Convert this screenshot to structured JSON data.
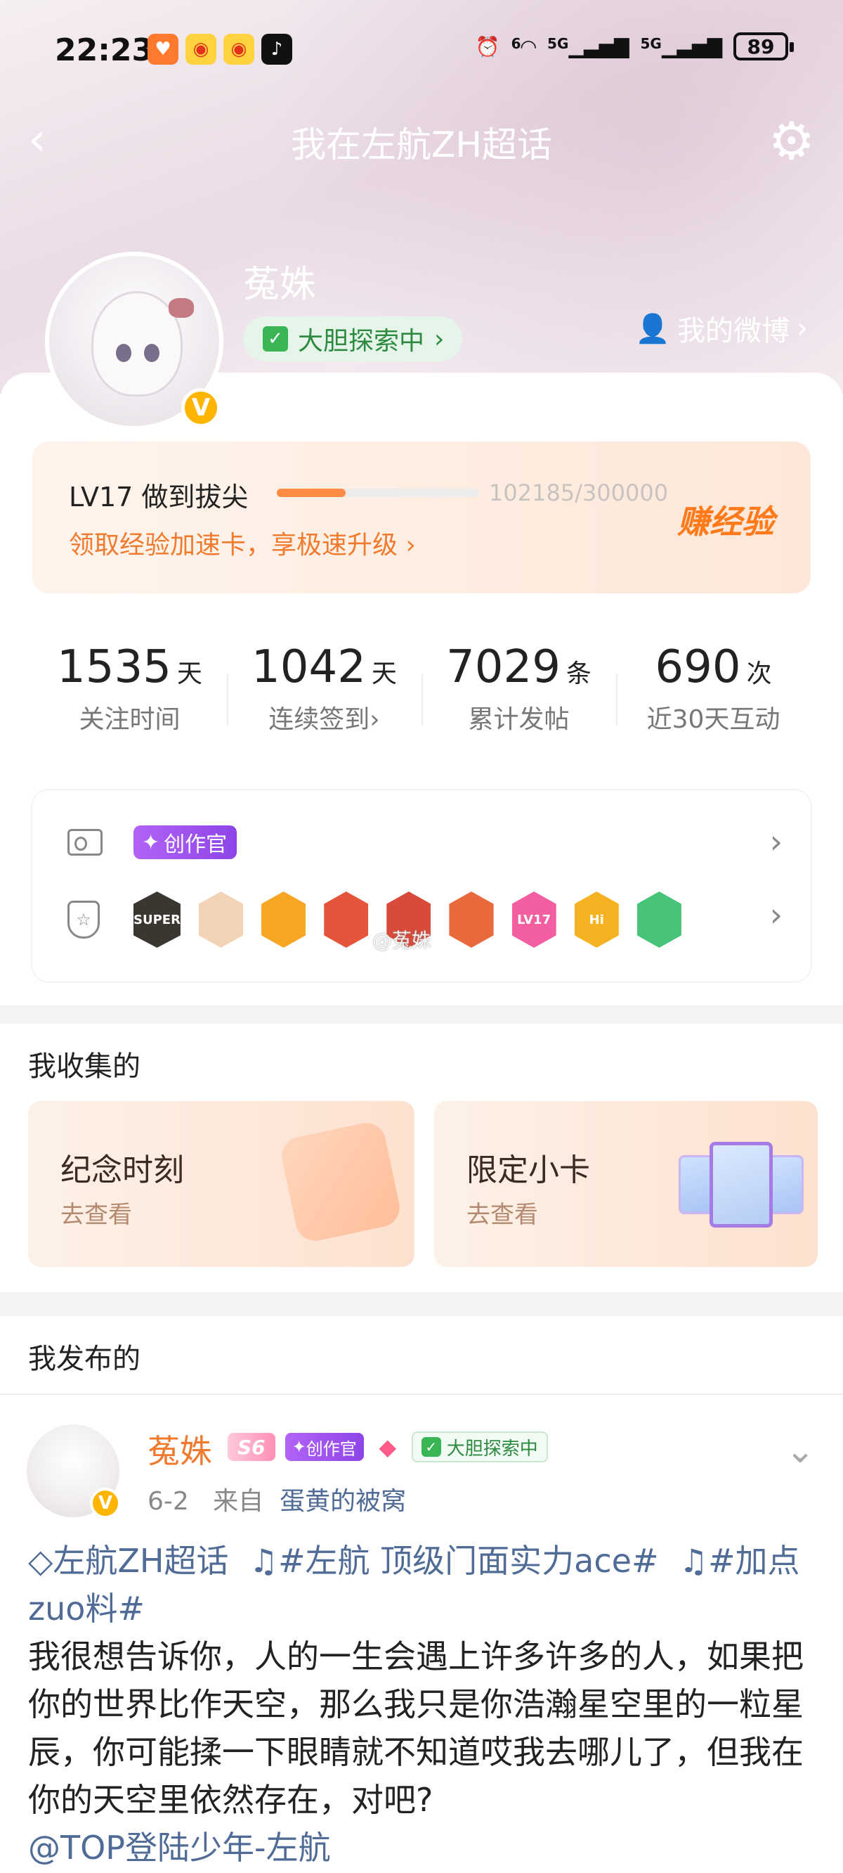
{
  "status_bar": {
    "time": "22:23",
    "battery": "89",
    "signal_labels": [
      "6",
      "5G",
      "5G"
    ]
  },
  "nav": {
    "title": "我在左航ZH超话"
  },
  "profile": {
    "username": "菟姝",
    "explore_tag": "大胆探索中",
    "my_weibo": "我的微博",
    "verified_mark": "V"
  },
  "level": {
    "title": "LV17 做到拔尖",
    "progress_text": "102185/300000",
    "progress_fraction": 0.3406,
    "link": "领取经验加速卡，享极速升级",
    "earn": "赚经验"
  },
  "stats": [
    {
      "num": "1535",
      "unit": "天",
      "label": "关注时间",
      "arrow": ""
    },
    {
      "num": "1042",
      "unit": "天",
      "label": "连续签到",
      "arrow": "›"
    },
    {
      "num": "7029",
      "unit": "条",
      "label": "累计发帖",
      "arrow": ""
    },
    {
      "num": "690",
      "unit": "次",
      "label": "近30天互动",
      "arrow": ""
    }
  ],
  "badges": {
    "creator_tag": "创作官",
    "medals": [
      {
        "text": "SUPER",
        "color": "#3b3630"
      },
      {
        "text": "",
        "color": "#f2d3b6"
      },
      {
        "text": "",
        "color": "#f5a623"
      },
      {
        "text": "",
        "color": "#e4553c"
      },
      {
        "text": "",
        "color": "#d84a3a"
      },
      {
        "text": "",
        "color": "#e86a3c"
      },
      {
        "text": "LV17",
        "color": "#f35ea0"
      },
      {
        "text": "Hi",
        "color": "#f5b324"
      },
      {
        "text": "",
        "color": "#47c47a"
      }
    ],
    "watermark": "@菟姝"
  },
  "collections": {
    "title": "我收集的",
    "items": [
      {
        "title": "纪念时刻",
        "sub": "去查看"
      },
      {
        "title": "限定小卡",
        "sub": "去查看"
      }
    ]
  },
  "posts": {
    "title": "我发布的",
    "post": {
      "author": "菟姝",
      "level_badge": "S6",
      "creator": "创作官",
      "explore": "大胆探索中",
      "date": "6-2",
      "from_label": "来自",
      "source": "蛋黄的被窝",
      "topic": "左航ZH超话",
      "hashtag1": "#左航 顶级门面实力ace#",
      "hashtag2": "#加点zuo料#",
      "body": "我很想告诉你，人的一生会遇上许多许多的人，如果把你的世界比作天空，那么我只是你浩瀚星空里的一粒星辰，你可能揉一下眼睛就不知道哎我去哪儿了，但我在你的天空里依然存在，对吧?",
      "mention": "@TOP登陆少年-左航"
    }
  }
}
